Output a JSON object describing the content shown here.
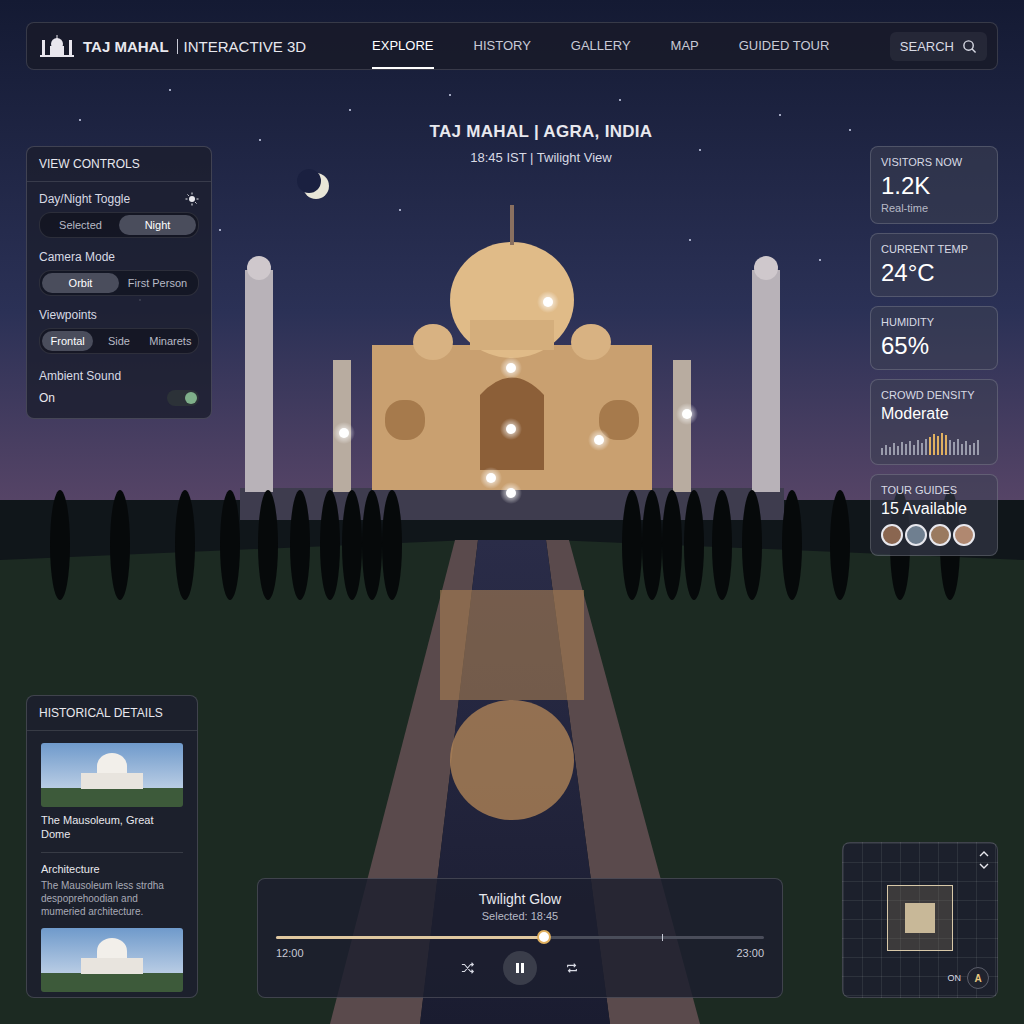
{
  "app": {
    "title": "TAJ MAHAL",
    "subtitle": "INTERACTIVE 3D"
  },
  "nav": [
    {
      "label": "EXPLORE",
      "selected": true
    },
    {
      "label": "HISTORY",
      "selected": false
    },
    {
      "label": "GALLERY",
      "selected": false
    },
    {
      "label": "MAP",
      "selected": false
    },
    {
      "label": "GUIDED TOUR",
      "selected": false
    }
  ],
  "search": {
    "label": "SEARCH"
  },
  "location": {
    "title": "TAJ MAHAL | AGRA, INDIA",
    "time": "18:45 IST | Twilight View"
  },
  "view_controls": {
    "title": "VIEW CONTROLS",
    "groups": [
      {
        "label": "Day/Night Toggle",
        "options": [
          {
            "label": "Selected",
            "selected": false
          },
          {
            "label": "Night",
            "selected": true
          }
        ]
      },
      {
        "label": "Camera Mode",
        "options": [
          {
            "label": "Orbit",
            "selected": true
          },
          {
            "label": "First Person",
            "selected": false
          }
        ]
      },
      {
        "label": "Viewpoints",
        "options": [
          {
            "label": "Frontal",
            "selected": true
          },
          {
            "label": "Side",
            "selected": false
          },
          {
            "label": "Minarets",
            "selected": false
          }
        ]
      }
    ],
    "ambient": {
      "label": "Ambient Sound",
      "value": "On",
      "on": true
    }
  },
  "stats": [
    {
      "kind": "plain",
      "label": "VISITORS NOW",
      "value": "1.2K",
      "note": "Real-time"
    },
    {
      "kind": "plain",
      "label": "CURRENT TEMP",
      "value": "24°C"
    },
    {
      "kind": "plain",
      "label": "HUMIDITY",
      "value": "65%"
    },
    {
      "kind": "bars",
      "label": "CROWD DENSITY",
      "value": "Moderate",
      "bars": [
        {
          "level": 0.3,
          "highlighted": false
        },
        {
          "level": 0.45,
          "highlighted": false
        },
        {
          "level": 0.35,
          "highlighted": false
        },
        {
          "level": 0.55,
          "highlighted": false
        },
        {
          "level": 0.4,
          "highlighted": false
        },
        {
          "level": 0.6,
          "highlighted": false
        },
        {
          "level": 0.5,
          "highlighted": false
        },
        {
          "level": 0.65,
          "highlighted": false
        },
        {
          "level": 0.45,
          "highlighted": false
        },
        {
          "level": 0.7,
          "highlighted": false
        },
        {
          "level": 0.55,
          "highlighted": false
        },
        {
          "level": 0.75,
          "highlighted": false
        },
        {
          "level": 0.8,
          "highlighted": true
        },
        {
          "level": 0.95,
          "highlighted": true
        },
        {
          "level": 0.85,
          "highlighted": true
        },
        {
          "level": 1.0,
          "highlighted": true
        },
        {
          "level": 0.9,
          "highlighted": true
        },
        {
          "level": 0.7,
          "highlighted": false
        },
        {
          "level": 0.6,
          "highlighted": false
        },
        {
          "level": 0.75,
          "highlighted": false
        },
        {
          "level": 0.5,
          "highlighted": false
        },
        {
          "level": 0.65,
          "highlighted": false
        },
        {
          "level": 0.45,
          "highlighted": false
        },
        {
          "level": 0.55,
          "highlighted": false
        },
        {
          "level": 0.7,
          "highlighted": false
        }
      ]
    },
    {
      "kind": "guides",
      "label": "TOUR GUIDES",
      "value": "15 Available",
      "avatars": [
        {
          "color": "#8a6650"
        },
        {
          "color": "#6f7f90"
        },
        {
          "color": "#9a7a60"
        },
        {
          "color": "#b08870"
        }
      ]
    }
  ],
  "historical": {
    "title": "HISTORICAL DETAILS",
    "items": [
      {
        "kind": "photo",
        "caption": "The Mausoleum, Great Dome"
      },
      {
        "kind": "text",
        "heading": "Architecture",
        "text": "The Mausoleum less strdha despoprehoodian and mumeried architecture."
      },
      {
        "kind": "photo",
        "caption": ""
      }
    ]
  },
  "player": {
    "title": "Twilight Glow",
    "selected": "Selected: 18:45",
    "start": "12:00",
    "end": "23:00",
    "level": 0.55,
    "marker": 0.79,
    "playing": true
  },
  "minimap": {
    "label": "ON",
    "compass": "A"
  }
}
